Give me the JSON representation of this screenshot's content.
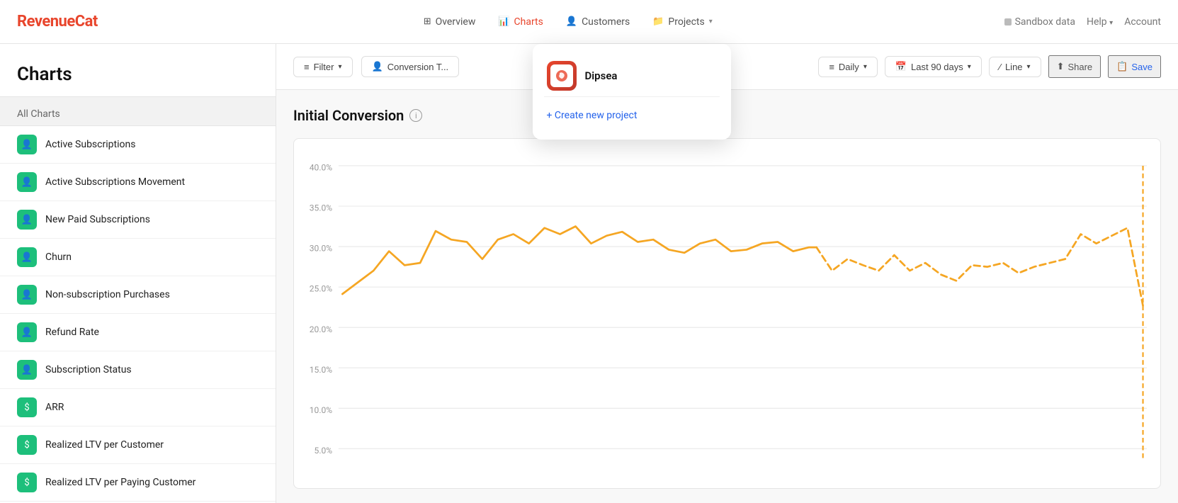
{
  "app": {
    "logo": "RevenueCat"
  },
  "nav": {
    "items": [
      {
        "id": "overview",
        "label": "Overview",
        "icon": "⊞",
        "active": false
      },
      {
        "id": "charts",
        "label": "Charts",
        "icon": "📊",
        "active": true
      },
      {
        "id": "customers",
        "label": "Customers",
        "icon": "👤",
        "active": false
      },
      {
        "id": "projects",
        "label": "Projects",
        "icon": "📁",
        "active": false,
        "hasDropdown": true
      }
    ],
    "right": [
      {
        "id": "sandbox",
        "label": "Sandbox data",
        "icon": "square"
      },
      {
        "id": "help",
        "label": "Help",
        "hasDropdown": true
      },
      {
        "id": "account",
        "label": "Account"
      }
    ]
  },
  "sidebar": {
    "title": "Charts",
    "section_title": "All Charts",
    "items": [
      {
        "id": "active-subscriptions",
        "label": "Active Subscriptions",
        "icon_type": "person",
        "color": "green"
      },
      {
        "id": "active-subscriptions-movement",
        "label": "Active Subscriptions Movement",
        "icon_type": "person",
        "color": "green"
      },
      {
        "id": "new-paid-subscriptions",
        "label": "New Paid Subscriptions",
        "icon_type": "person",
        "color": "green"
      },
      {
        "id": "churn",
        "label": "Churn",
        "icon_type": "person",
        "color": "green"
      },
      {
        "id": "non-subscription-purchases",
        "label": "Non-subscription Purchases",
        "icon_type": "person",
        "color": "green"
      },
      {
        "id": "refund-rate",
        "label": "Refund Rate",
        "icon_type": "person",
        "color": "green"
      },
      {
        "id": "subscription-status",
        "label": "Subscription Status",
        "icon_type": "person",
        "color": "green"
      },
      {
        "id": "arr",
        "label": "ARR",
        "icon_type": "dollar",
        "color": "green"
      },
      {
        "id": "realized-ltv-customer",
        "label": "Realized LTV per Customer",
        "icon_type": "dollar",
        "color": "green"
      },
      {
        "id": "realized-ltv-paying",
        "label": "Realized LTV per Paying Customer",
        "icon_type": "dollar",
        "color": "green"
      }
    ]
  },
  "toolbar": {
    "filter_label": "Filter",
    "conversion_label": "Conversion T...",
    "daily_label": "Daily",
    "last90_label": "Last 90 days",
    "line_label": "Line",
    "share_label": "Share",
    "save_label": "Save"
  },
  "chart": {
    "title": "Initial Conversion",
    "y_labels": [
      "40.0%",
      "35.0%",
      "30.0%",
      "25.0%",
      "20.0%",
      "15.0%",
      "10.0%",
      "5.0%"
    ],
    "colors": {
      "solid_line": "#f5a623",
      "dashed_line": "#f5a623"
    }
  },
  "projects_dropdown": {
    "project_name": "Dipsea",
    "create_label": "+ Create new project"
  }
}
